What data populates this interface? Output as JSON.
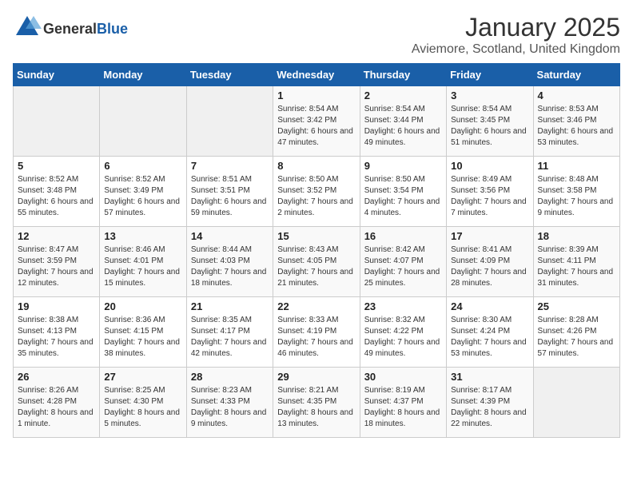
{
  "header": {
    "logo_general": "General",
    "logo_blue": "Blue",
    "title": "January 2025",
    "subtitle": "Aviemore, Scotland, United Kingdom"
  },
  "weekdays": [
    "Sunday",
    "Monday",
    "Tuesday",
    "Wednesday",
    "Thursday",
    "Friday",
    "Saturday"
  ],
  "weeks": [
    [
      {
        "day": "",
        "info": ""
      },
      {
        "day": "",
        "info": ""
      },
      {
        "day": "",
        "info": ""
      },
      {
        "day": "1",
        "info": "Sunrise: 8:54 AM\nSunset: 3:42 PM\nDaylight: 6 hours and 47 minutes."
      },
      {
        "day": "2",
        "info": "Sunrise: 8:54 AM\nSunset: 3:44 PM\nDaylight: 6 hours and 49 minutes."
      },
      {
        "day": "3",
        "info": "Sunrise: 8:54 AM\nSunset: 3:45 PM\nDaylight: 6 hours and 51 minutes."
      },
      {
        "day": "4",
        "info": "Sunrise: 8:53 AM\nSunset: 3:46 PM\nDaylight: 6 hours and 53 minutes."
      }
    ],
    [
      {
        "day": "5",
        "info": "Sunrise: 8:52 AM\nSunset: 3:48 PM\nDaylight: 6 hours and 55 minutes."
      },
      {
        "day": "6",
        "info": "Sunrise: 8:52 AM\nSunset: 3:49 PM\nDaylight: 6 hours and 57 minutes."
      },
      {
        "day": "7",
        "info": "Sunrise: 8:51 AM\nSunset: 3:51 PM\nDaylight: 6 hours and 59 minutes."
      },
      {
        "day": "8",
        "info": "Sunrise: 8:50 AM\nSunset: 3:52 PM\nDaylight: 7 hours and 2 minutes."
      },
      {
        "day": "9",
        "info": "Sunrise: 8:50 AM\nSunset: 3:54 PM\nDaylight: 7 hours and 4 minutes."
      },
      {
        "day": "10",
        "info": "Sunrise: 8:49 AM\nSunset: 3:56 PM\nDaylight: 7 hours and 7 minutes."
      },
      {
        "day": "11",
        "info": "Sunrise: 8:48 AM\nSunset: 3:58 PM\nDaylight: 7 hours and 9 minutes."
      }
    ],
    [
      {
        "day": "12",
        "info": "Sunrise: 8:47 AM\nSunset: 3:59 PM\nDaylight: 7 hours and 12 minutes."
      },
      {
        "day": "13",
        "info": "Sunrise: 8:46 AM\nSunset: 4:01 PM\nDaylight: 7 hours and 15 minutes."
      },
      {
        "day": "14",
        "info": "Sunrise: 8:44 AM\nSunset: 4:03 PM\nDaylight: 7 hours and 18 minutes."
      },
      {
        "day": "15",
        "info": "Sunrise: 8:43 AM\nSunset: 4:05 PM\nDaylight: 7 hours and 21 minutes."
      },
      {
        "day": "16",
        "info": "Sunrise: 8:42 AM\nSunset: 4:07 PM\nDaylight: 7 hours and 25 minutes."
      },
      {
        "day": "17",
        "info": "Sunrise: 8:41 AM\nSunset: 4:09 PM\nDaylight: 7 hours and 28 minutes."
      },
      {
        "day": "18",
        "info": "Sunrise: 8:39 AM\nSunset: 4:11 PM\nDaylight: 7 hours and 31 minutes."
      }
    ],
    [
      {
        "day": "19",
        "info": "Sunrise: 8:38 AM\nSunset: 4:13 PM\nDaylight: 7 hours and 35 minutes."
      },
      {
        "day": "20",
        "info": "Sunrise: 8:36 AM\nSunset: 4:15 PM\nDaylight: 7 hours and 38 minutes."
      },
      {
        "day": "21",
        "info": "Sunrise: 8:35 AM\nSunset: 4:17 PM\nDaylight: 7 hours and 42 minutes."
      },
      {
        "day": "22",
        "info": "Sunrise: 8:33 AM\nSunset: 4:19 PM\nDaylight: 7 hours and 46 minutes."
      },
      {
        "day": "23",
        "info": "Sunrise: 8:32 AM\nSunset: 4:22 PM\nDaylight: 7 hours and 49 minutes."
      },
      {
        "day": "24",
        "info": "Sunrise: 8:30 AM\nSunset: 4:24 PM\nDaylight: 7 hours and 53 minutes."
      },
      {
        "day": "25",
        "info": "Sunrise: 8:28 AM\nSunset: 4:26 PM\nDaylight: 7 hours and 57 minutes."
      }
    ],
    [
      {
        "day": "26",
        "info": "Sunrise: 8:26 AM\nSunset: 4:28 PM\nDaylight: 8 hours and 1 minute."
      },
      {
        "day": "27",
        "info": "Sunrise: 8:25 AM\nSunset: 4:30 PM\nDaylight: 8 hours and 5 minutes."
      },
      {
        "day": "28",
        "info": "Sunrise: 8:23 AM\nSunset: 4:33 PM\nDaylight: 8 hours and 9 minutes."
      },
      {
        "day": "29",
        "info": "Sunrise: 8:21 AM\nSunset: 4:35 PM\nDaylight: 8 hours and 13 minutes."
      },
      {
        "day": "30",
        "info": "Sunrise: 8:19 AM\nSunset: 4:37 PM\nDaylight: 8 hours and 18 minutes."
      },
      {
        "day": "31",
        "info": "Sunrise: 8:17 AM\nSunset: 4:39 PM\nDaylight: 8 hours and 22 minutes."
      },
      {
        "day": "",
        "info": ""
      }
    ]
  ]
}
